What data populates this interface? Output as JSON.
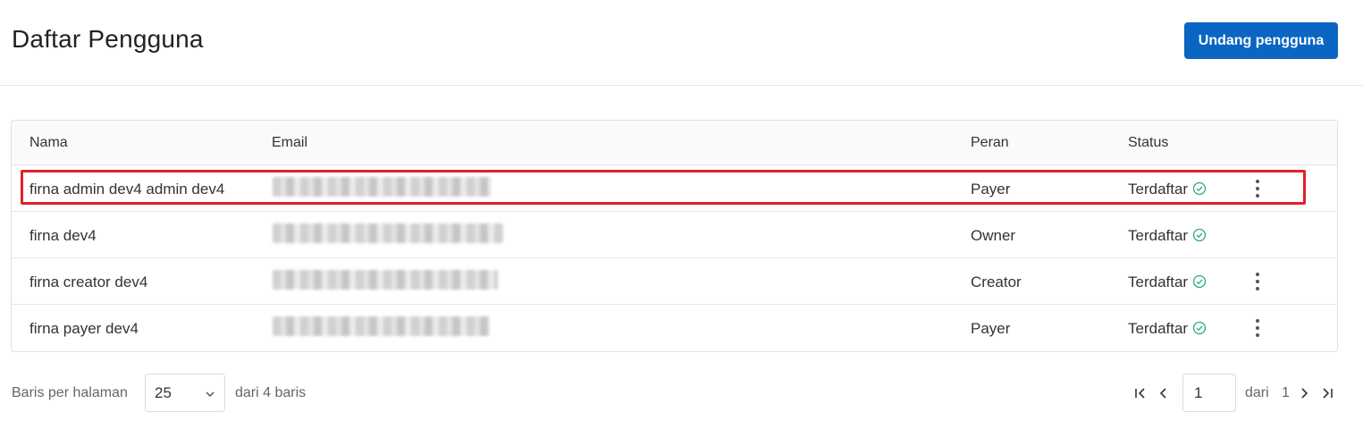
{
  "header": {
    "title": "Daftar Pengguna",
    "invite_button": "Undang pengguna"
  },
  "table": {
    "columns": [
      "Nama",
      "Email",
      "Peran",
      "Status"
    ],
    "rows": [
      {
        "name": "firna admin dev4 admin dev4",
        "email_redacted": true,
        "role": "Payer",
        "status": "Terdaftar",
        "has_menu": true
      },
      {
        "name": "firna dev4",
        "email_redacted": true,
        "role": "Owner",
        "status": "Terdaftar",
        "has_menu": false
      },
      {
        "name": "firna creator dev4",
        "email_redacted": true,
        "role": "Creator",
        "status": "Terdaftar",
        "has_menu": true
      },
      {
        "name": "firna payer dev4",
        "email_redacted": true,
        "role": "Payer",
        "status": "Terdaftar",
        "has_menu": true
      }
    ]
  },
  "status_icon": "check-circle-icon",
  "row_menu_icon": "kebab-menu-icon",
  "highlighted_row": 0,
  "colors": {
    "accent": "#0a66c2",
    "highlight_border": "#e0202e",
    "status_ok": "#2eaa73"
  },
  "footer": {
    "rows_per_page_label": "Baris per halaman",
    "rows_per_page_value": "25",
    "total_rows_text": "dari 4 baris",
    "current_page": "1",
    "of_label": "dari",
    "total_pages": "1"
  }
}
